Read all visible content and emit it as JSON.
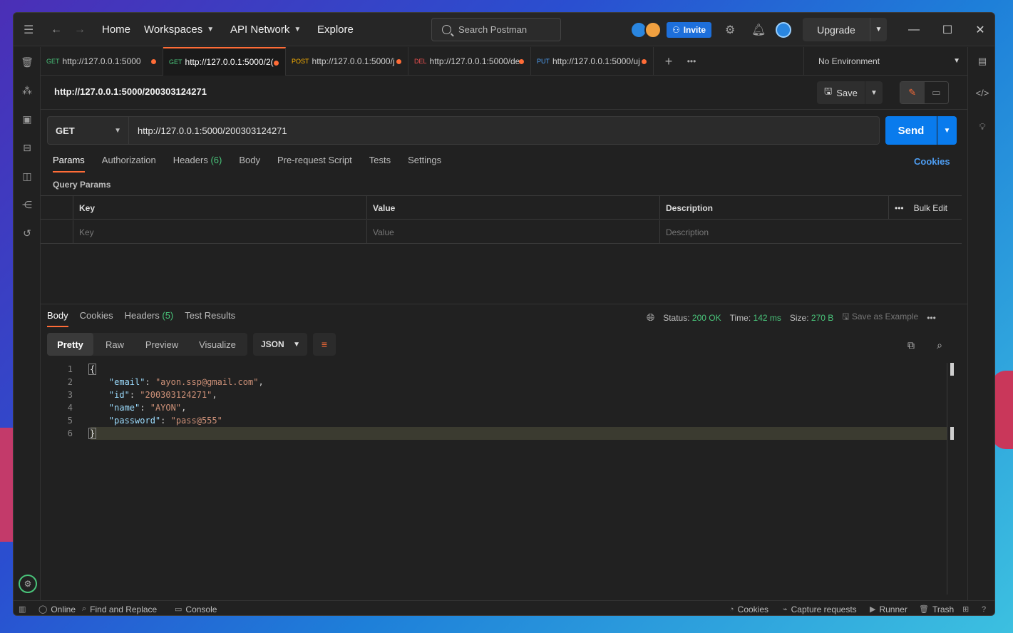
{
  "titlebar": {
    "nav_home": "Home",
    "nav_workspaces": "Workspaces",
    "nav_api_network": "API Network",
    "nav_explore": "Explore",
    "search_placeholder": "Search Postman",
    "invite_label": "Invite",
    "upgrade_label": "Upgrade"
  },
  "tabs": [
    {
      "method": "GET",
      "url": "http://127.0.0.1:5000",
      "method_color": "#49c47a"
    },
    {
      "method": "GET",
      "url": "http://127.0.0.1:5000/2(",
      "method_color": "#49c47a"
    },
    {
      "method": "POST",
      "url": "http://127.0.0.1:5000/j",
      "method_color": "#ffb400"
    },
    {
      "method": "DEL",
      "url": "http://127.0.0.1:5000/de",
      "method_color": "#f05050"
    },
    {
      "method": "PUT",
      "url": "http://127.0.0.1:5000/uj",
      "method_color": "#4e9ff5"
    }
  ],
  "environment": "No Environment",
  "request": {
    "title": "http://127.0.0.1:5000/200303124271",
    "save_label": "Save",
    "method": "GET",
    "url": "http://127.0.0.1:5000/200303124271",
    "send_label": "Send"
  },
  "request_tabs": {
    "params": "Params",
    "authorization": "Authorization",
    "headers": "Headers",
    "headers_count": "(6)",
    "body": "Body",
    "prerequest": "Pre-request Script",
    "tests": "Tests",
    "settings": "Settings",
    "cookies": "Cookies"
  },
  "query_params": {
    "title": "Query Params",
    "col_key": "Key",
    "col_value": "Value",
    "col_description": "Description",
    "bulk_edit": "Bulk Edit",
    "ph_key": "Key",
    "ph_value": "Value",
    "ph_description": "Description"
  },
  "response_tabs": {
    "body": "Body",
    "cookies": "Cookies",
    "headers": "Headers",
    "headers_count": "(5)",
    "test_results": "Test Results"
  },
  "response_meta": {
    "status_label": "Status:",
    "status_value": "200 OK",
    "time_label": "Time:",
    "time_value": "142 ms",
    "size_label": "Size:",
    "size_value": "270 B",
    "save_example": "Save as Example"
  },
  "format": {
    "pretty": "Pretty",
    "raw": "Raw",
    "preview": "Preview",
    "visualize": "Visualize",
    "type": "JSON"
  },
  "code": {
    "l1": "{",
    "k_email": "\"email\"",
    "v_email": "\"ayon.ssp@gmail.com\"",
    "k_id": "\"id\"",
    "v_id": "\"200303124271\"",
    "k_name": "\"name\"",
    "v_name": "\"AYON\"",
    "k_password": "\"password\"",
    "v_password": "\"pass@555\"",
    "l6": "}"
  },
  "statusbar": {
    "online": "Online",
    "find_replace": "Find and Replace",
    "console": "Console",
    "cookies": "Cookies",
    "capture": "Capture requests",
    "runner": "Runner",
    "trash": "Trash"
  }
}
